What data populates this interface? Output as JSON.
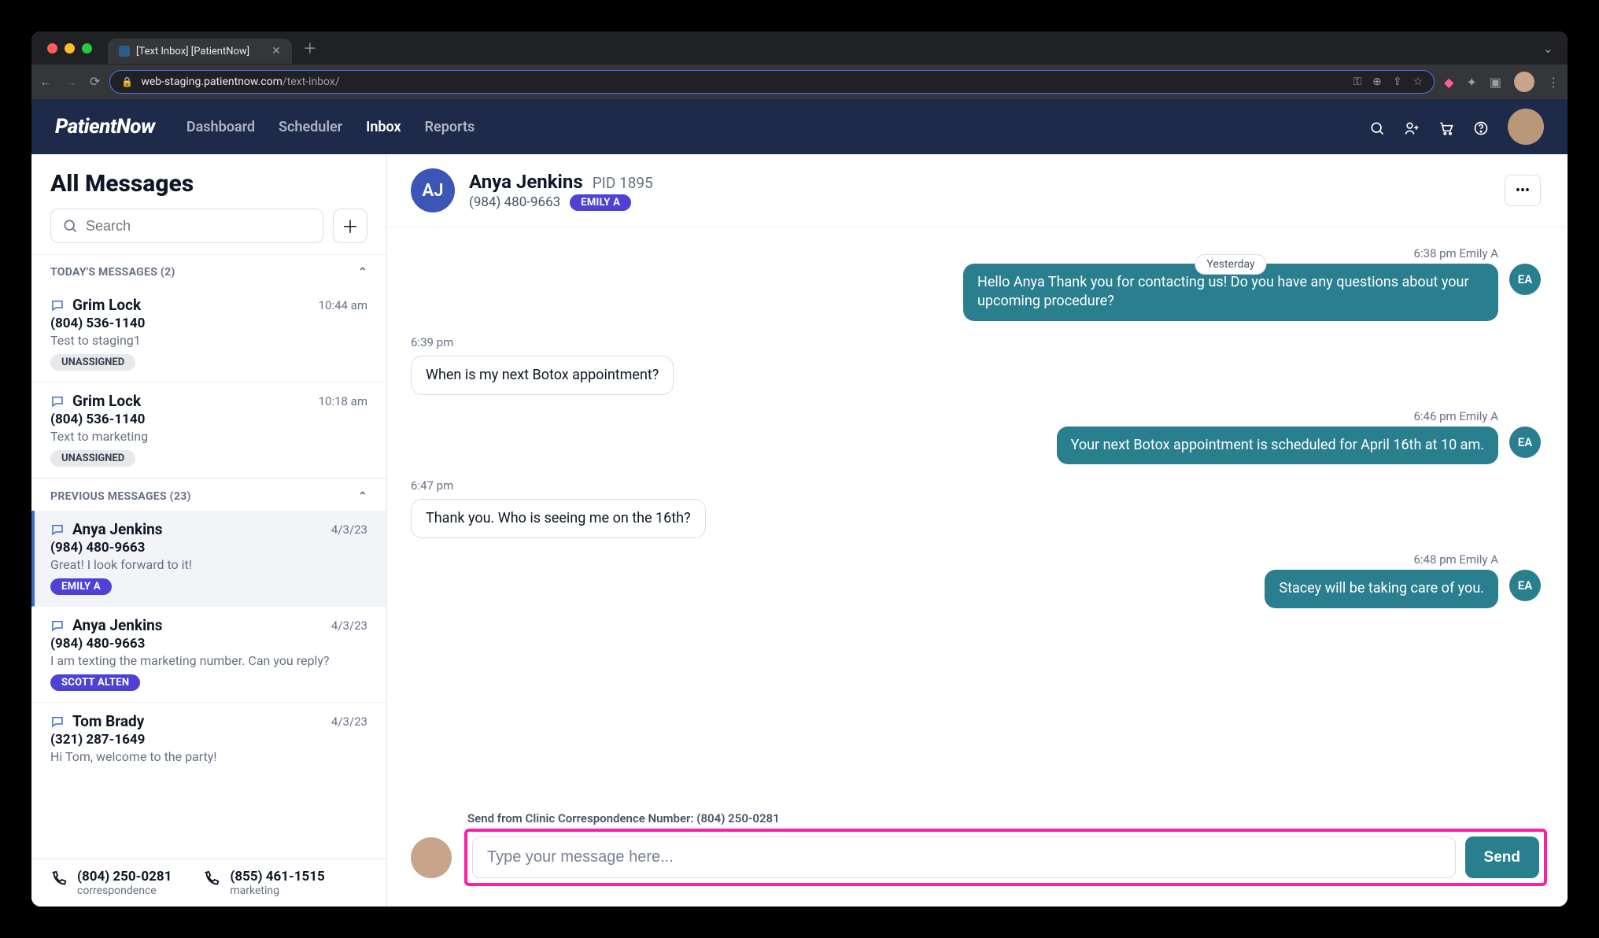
{
  "browser": {
    "tab_title": "[Text Inbox] [PatientNow]",
    "url_host": "web-staging.patientnow.com",
    "url_path": "/text-inbox/"
  },
  "header": {
    "brand": "PatientNow",
    "nav": {
      "dashboard": "Dashboard",
      "scheduler": "Scheduler",
      "inbox": "Inbox",
      "reports": "Reports"
    }
  },
  "sidebar": {
    "title": "All Messages",
    "search_placeholder": "Search",
    "sections": {
      "today": "TODAY'S MESSAGES (2)",
      "previous": "PREVIOUS MESSAGES (23)"
    },
    "items": [
      {
        "name": "Grim Lock",
        "time": "10:44 am",
        "phone": "(804) 536-1140",
        "preview": "Test to staging1",
        "tag": "UNASSIGNED",
        "tag_style": "gray"
      },
      {
        "name": "Grim Lock",
        "time": "10:18 am",
        "phone": "(804) 536-1140",
        "preview": "Text to marketing",
        "tag": "UNASSIGNED",
        "tag_style": "gray"
      },
      {
        "name": "Anya Jenkins",
        "time": "4/3/23",
        "phone": "(984) 480-9663",
        "preview": "Great! I look forward to it!",
        "tag": "EMILY A",
        "tag_style": "purple",
        "selected": true
      },
      {
        "name": "Anya Jenkins",
        "time": "4/3/23",
        "phone": "(984) 480-9663",
        "preview": "I am texting the marketing number. Can you reply?",
        "tag": "SCOTT ALTEN",
        "tag_style": "purple"
      },
      {
        "name": "Tom Brady",
        "time": "4/3/23",
        "phone": "(321) 287-1649",
        "preview": "Hi Tom, welcome to the party!",
        "tag": "",
        "tag_style": ""
      }
    ],
    "footer": [
      {
        "number": "(804) 250-0281",
        "label": "correspondence"
      },
      {
        "number": "(855) 461-1515",
        "label": "marketing"
      }
    ]
  },
  "chat": {
    "avatar_initials": "AJ",
    "name": "Anya Jenkins",
    "pid": "PID 1895",
    "phone": "(984) 480-9663",
    "assignee_tag": "EMILY A",
    "date_pill": "Yesterday",
    "messages": [
      {
        "dir": "out",
        "meta": "6:38 pm  Emily A",
        "avatar": "EA",
        "text": "Hello Anya Thank you for contacting us! Do you have any questions about your upcoming procedure?"
      },
      {
        "dir": "in",
        "meta": "6:39 pm",
        "text": "When is my next Botox appointment?"
      },
      {
        "dir": "out",
        "meta": "6:46 pm  Emily A",
        "avatar": "EA",
        "text": "Your next Botox appointment is scheduled for April 16th at 10 am."
      },
      {
        "dir": "in",
        "meta": "6:47 pm",
        "text": "Thank you. Who is seeing me on the 16th?"
      },
      {
        "dir": "out",
        "meta": "6:48 pm  Emily A",
        "avatar": "EA",
        "text": "Stacey will be taking care of you."
      }
    ],
    "send_from_label": "Send from Clinic Correspondence Number: (804) 250-0281",
    "compose_placeholder": "Type your message here...",
    "send_button": "Send"
  }
}
